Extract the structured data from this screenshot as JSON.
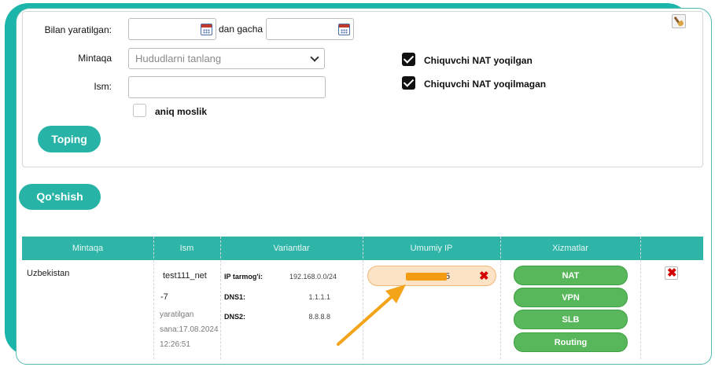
{
  "filters": {
    "date_from_label": "Bilan yaratilgan:",
    "date_to_label": "dan gacha",
    "region_label": "Mintaqa",
    "region_placeholder": "Hududlarni tanlang",
    "name_label": "Ism:",
    "exact_match_label": "aniq moslik",
    "exact_match_checked": false,
    "nat_enabled_label": "Chiquvchi NAT yoqilgan",
    "nat_enabled_checked": true,
    "nat_disabled_label": "Chiquvchi NAT yoqilmagan",
    "nat_disabled_checked": true,
    "search_button": "Toping"
  },
  "add_button": "Qo'shish",
  "table": {
    "headers": [
      "Mintaqa",
      "Ism",
      "Variantlar",
      "Umumiy IP",
      "Xizmatlar",
      ""
    ],
    "rows": [
      {
        "region": "Uzbekistan",
        "name_line1": "test111_net",
        "name_line2": "-7",
        "created_line1": "yaratilgan",
        "created_line2": "sana:17.08.2024",
        "created_line3": "12:26:51",
        "options": {
          "ip_network_label": "IP tarmog'i:",
          "ip_network_value": "192.168.0.0/24",
          "dns1_label": "DNS1:",
          "dns1_value": "1.1.1.1",
          "dns2_label": "DNS2:",
          "dns2_value": "8.8.8.8"
        },
        "public_ip_visible": "5",
        "services": [
          "NAT",
          "VPN",
          "SLB",
          "Routing"
        ]
      }
    ]
  },
  "icons": {
    "calendar": "calendar-icon",
    "broom": "broom-icon",
    "chevron": "chevron-down-icon",
    "remove": "close-icon",
    "delete": "delete-icon",
    "arrow": "arrow-icon"
  },
  "colors": {
    "teal": "#27b3a6",
    "service_green": "#57b75a",
    "ip_pill": "#fde3c6",
    "arrow": "#f49b14",
    "delete_red": "#d40000"
  }
}
